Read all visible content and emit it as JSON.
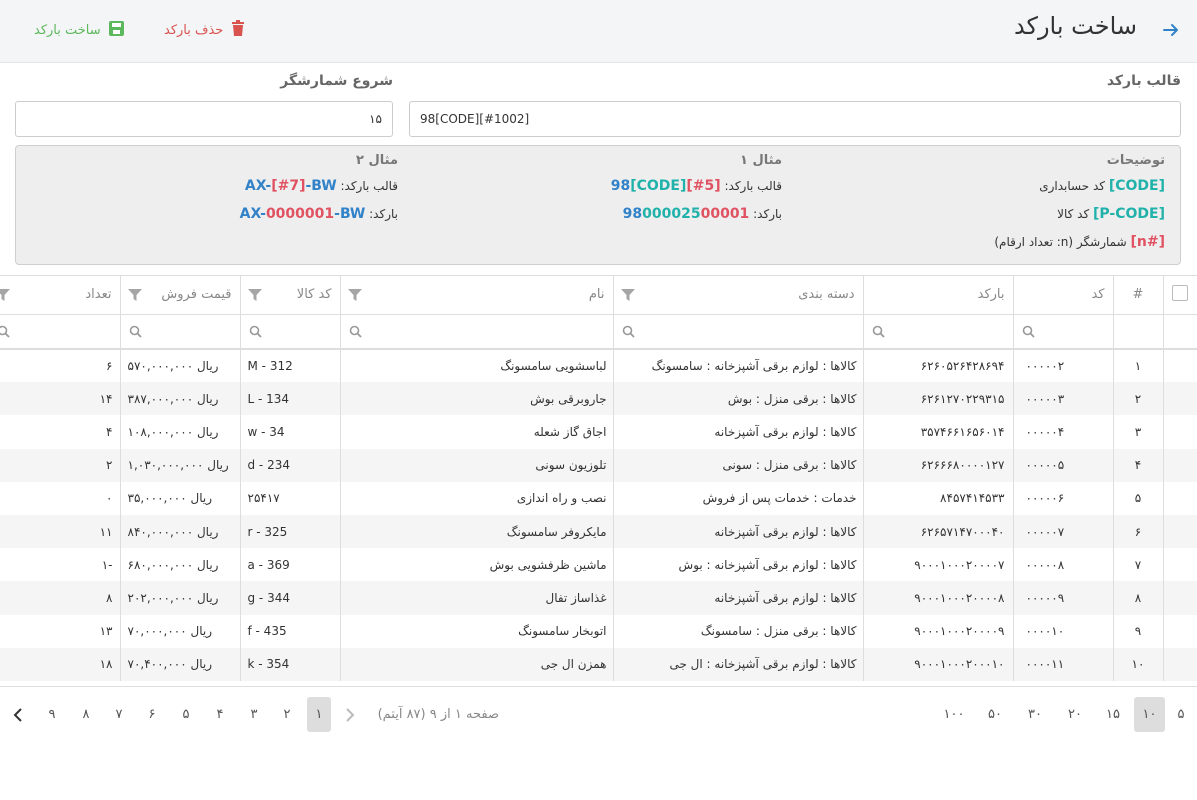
{
  "header": {
    "title": "ساخت بارکد",
    "delete_label": "حذف بارکد",
    "create_label": "ساخت بارکد"
  },
  "form": {
    "template_label": "قالب بارکد",
    "template_value": "98[CODE][#1002]",
    "start_label": "شروع شمارشگر",
    "start_value": "۱۵"
  },
  "help": {
    "desc_title": "توضیحات",
    "ex1_title": "مثال ۱",
    "ex2_title": "مثال ۲",
    "code_tag": "[CODE]",
    "code_desc": "کد حسابداری",
    "pcode_tag": "[P-CODE]",
    "pcode_desc": "کد کالا",
    "n_tag": "[#n]",
    "n_desc": "شمارشگر (n: تعداد ارقام)",
    "template_caption": "قالب بارکد:",
    "barcode_caption": "بارکد:",
    "ex1_tmpl_a": "98",
    "ex1_tmpl_b": "[CODE]",
    "ex1_tmpl_c": "[#5]",
    "ex1_bar_a": "98",
    "ex1_bar_b": "000025",
    "ex1_bar_c": "00001",
    "ex2_tmpl_a": "AX-",
    "ex2_tmpl_b": "[#7]",
    "ex2_tmpl_c": "-BW",
    "ex2_bar_a": "AX-",
    "ex2_bar_b": "0000001",
    "ex2_bar_c": "-BW"
  },
  "columns": {
    "idx": "#",
    "code": "کد",
    "barcode": "بارکد",
    "category": "دسته بندی",
    "name": "نام",
    "product_code": "کد کالا",
    "price": "قیمت فروش",
    "qty": "تعداد"
  },
  "rows": [
    {
      "idx": "۱",
      "code": "۰۰۰۰۰۲",
      "barcode": "۶۲۶۰۵۲۶۴۲۸۶۹۴",
      "category": "کالاها : لوازم برقی آشپزخانه : سامسونگ",
      "name": "لباسشویی سامسونگ",
      "product_code": "M - 312",
      "price": "ریال ۵۷۰,۰۰۰,۰۰۰",
      "qty": "۶"
    },
    {
      "idx": "۲",
      "code": "۰۰۰۰۰۳",
      "barcode": "۶۲۶۱۲۷۰۲۲۹۳۱۵",
      "category": "کالاها : برقی منزل : بوش",
      "name": "جاروبرقی بوش",
      "product_code": "L - 134",
      "price": "ریال ۳۸۷,۰۰۰,۰۰۰",
      "qty": "۱۴"
    },
    {
      "idx": "۳",
      "code": "۰۰۰۰۰۴",
      "barcode": "۳۵۷۴۶۶۱۶۵۶۰۱۴",
      "category": "کالاها : لوازم برقی آشپزخانه",
      "name": "اجاق گاز شعله",
      "product_code": "w - 34",
      "price": "ریال ۱۰۸,۰۰۰,۰۰۰",
      "qty": "۴"
    },
    {
      "idx": "۴",
      "code": "۰۰۰۰۰۵",
      "barcode": "۶۲۶۶۶۸۰۰۰۰۱۲۷",
      "category": "کالاها : برقی منزل : سونی",
      "name": "تلوزیون سونی",
      "product_code": "d - 234",
      "price": "ریال ۱,۰۳۰,۰۰۰,۰۰۰",
      "qty": "۲"
    },
    {
      "idx": "۵",
      "code": "۰۰۰۰۰۶",
      "barcode": "۸۴۵۷۴۱۴۵۳۳",
      "category": "خدمات : خدمات پس از فروش",
      "name": "نصب و راه اندازی",
      "product_code": "۲۵۴۱۷",
      "price": "ریال ۳۵,۰۰۰,۰۰۰",
      "qty": "۰"
    },
    {
      "idx": "۶",
      "code": "۰۰۰۰۰۷",
      "barcode": "۶۲۶۵۷۱۴۷۰۰۰۴۰",
      "category": "کالاها : لوازم برقی آشپزخانه",
      "name": "مایکروفر سامسونگ",
      "product_code": "r - 325",
      "price": "ریال ۸۴۰,۰۰۰,۰۰۰",
      "qty": "۱۱"
    },
    {
      "idx": "۷",
      "code": "۰۰۰۰۰۸",
      "barcode": "۹۰۰۰۱۰۰۰۲۰۰۰۰۷",
      "category": "کالاها : لوازم برقی آشپزخانه : بوش",
      "name": "ماشین ظرفشویی بوش",
      "product_code": "a - 369",
      "price": "ریال ۶۸۰,۰۰۰,۰۰۰",
      "qty": "-۱"
    },
    {
      "idx": "۸",
      "code": "۰۰۰۰۰۹",
      "barcode": "۹۰۰۰۱۰۰۰۲۰۰۰۰۸",
      "category": "کالاها : لوازم برقی آشپزخانه",
      "name": "غذاساز تفال",
      "product_code": "g - 344",
      "price": "ریال ۲۰۲,۰۰۰,۰۰۰",
      "qty": "۸"
    },
    {
      "idx": "۹",
      "code": "۰۰۰۰۱۰",
      "barcode": "۹۰۰۰۱۰۰۰۲۰۰۰۰۹",
      "category": "کالاها : برقی منزل : سامسونگ",
      "name": "اتوبخار سامسونگ",
      "product_code": "f - 435",
      "price": "ریال ۷۰,۰۰۰,۰۰۰",
      "qty": "۱۳"
    },
    {
      "idx": "۱۰",
      "code": "۰۰۰۰۱۱",
      "barcode": "۹۰۰۰۱۰۰۰۲۰۰۰۱۰",
      "category": "کالاها : لوازم برقی آشپزخانه : ال جی",
      "name": "همزن ال جی",
      "product_code": "k - 354",
      "price": "ریال ۷۰,۴۰۰,۰۰۰",
      "qty": "۱۸"
    }
  ],
  "pager": {
    "page_sizes": [
      "۵",
      "۱۰",
      "۱۵",
      "۲۰",
      "۳۰",
      "۵۰",
      "۱۰۰"
    ],
    "active_size": "۱۰",
    "info": "صفحه ۱ از ۹ (۸۷ آیتم)",
    "pages": [
      "۱",
      "۲",
      "۳",
      "۴",
      "۵",
      "۶",
      "۷",
      "۸",
      "۹"
    ],
    "current_page": "۱"
  },
  "colors": {
    "delete": "#d9534f",
    "create": "#5cb85c",
    "tag_green": "#20b2aa",
    "tag_red": "#e05261",
    "tag_blue": "#3182c8",
    "back_arrow": "#3182c8"
  },
  "icons": {
    "back": "arrow-right-icon",
    "delete": "trash-icon",
    "create": "save-icon",
    "filter": "filter-icon",
    "search": "search-icon",
    "prev": "chevron-left-icon",
    "next": "chevron-left-icon"
  }
}
